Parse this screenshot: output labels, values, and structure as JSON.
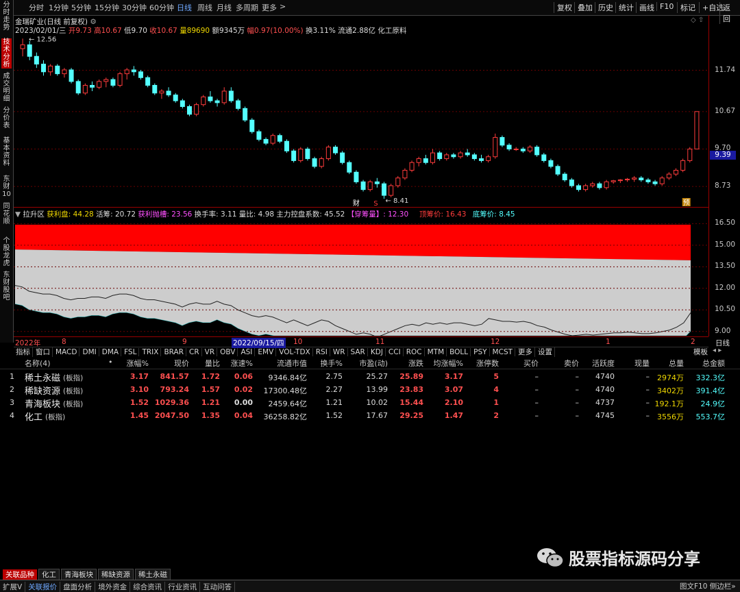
{
  "toolbar": {
    "periods": [
      "分时",
      "1分钟",
      "5分钟",
      "15分钟",
      "30分钟",
      "60分钟",
      "日线",
      "周线",
      "月线",
      "多周期",
      "更多"
    ],
    "active_period": "日线",
    "right_buttons": [
      "复权",
      "叠加",
      "历史",
      "统计",
      "画线",
      "F10",
      "标记",
      "+自选",
      "返回"
    ]
  },
  "sidebar": {
    "items": [
      "分时走势",
      "技术分析",
      "成交明细",
      "分价表",
      "基本资料",
      "东财10",
      "同花顺",
      "个股龙虎",
      "东财股吧"
    ],
    "active": "技术分析"
  },
  "stock": {
    "title": "金瑞矿业(日线 前复权)",
    "date": "2023/02/01/三",
    "open_label": "开",
    "open": "9.73",
    "high_label": "高",
    "high": "10.67",
    "low_label": "低",
    "low": "9.70",
    "close_label": "收",
    "close": "10.67",
    "vol_label": "量",
    "vol": "89690",
    "amt_label": "额",
    "amt": "9345万",
    "chg_label": "幅",
    "chg": "0.97(10.00%)",
    "turn_label": "换",
    "turn": "3.11%",
    "float_label": "流通",
    "float": "2.88亿",
    "industry": "化工原料",
    "max_mark": "12.56",
    "min_mark": "8.41",
    "current_price": "9.39",
    "markers": {
      "cai": "财",
      "s": "S",
      "yu": "预"
    },
    "price_axis": [
      "11.74",
      "10.67",
      "9.70",
      "8.73"
    ]
  },
  "chip": {
    "title": "拉升区",
    "profit_label": "获利盘",
    "profit": "44.28",
    "active_label": "活筹",
    "active": "20.72",
    "retire_label": "获利抛槽",
    "retire": "23.56",
    "turnover_label": "换手率",
    "turnover": "3.11",
    "vr_label": "量比",
    "vr": "4.98",
    "ctrl_label": "主力控盘系数",
    "ctrl": "45.52",
    "cross_label": "【穿筹量】",
    "cross": "12.30",
    "top_label": "顶筹价",
    "top": "16.43",
    "bottom_label": "底筹价",
    "bottom": "8.45",
    "axis": [
      "16.50",
      "15.00",
      "13.50",
      "12.00",
      "10.50",
      "9.00"
    ]
  },
  "timeline": {
    "labels": [
      "2022年",
      "8",
      "9",
      "2022/09/15/四",
      "10",
      "11",
      "12",
      "1",
      "2"
    ],
    "period": "日线"
  },
  "indicator_tabs": [
    "指标",
    "窗口",
    "MACD",
    "DMI",
    "DMA",
    "FSL",
    "TRIX",
    "BRAR",
    "CR",
    "VR",
    "OBV",
    "ASI",
    "EMV",
    "VOL-TDX",
    "RSI",
    "WR",
    "SAR",
    "KDJ",
    "CCI",
    "ROC",
    "MTM",
    "BOLL",
    "PSY",
    "MCST",
    "更多",
    "设置"
  ],
  "template_btn": "模板",
  "table": {
    "headers": [
      "名称(4)",
      "•",
      "涨幅%",
      "现价",
      "量比",
      "涨速%",
      "流通市值",
      "换手%",
      "市盈(动)",
      "涨跌",
      "均涨幅%",
      "涨停数",
      "买价",
      "卖价",
      "活跃度",
      "现量",
      "总量",
      "总金额"
    ],
    "rows": [
      {
        "idx": "1",
        "name": "稀土永磁",
        "tag": "(板指)",
        "chg": "3.17",
        "price": "841.57",
        "vr": "1.72",
        "spd": "0.06",
        "mcap": "9346.84亿",
        "turn": "2.75",
        "pe": "25.27",
        "diff": "25.89",
        "avg": "3.17",
        "limit": "5",
        "buy": "–",
        "sell": "–",
        "act": "4740",
        "cur": "–",
        "vol": "2974万",
        "amt": "332.3亿"
      },
      {
        "idx": "2",
        "name": "稀缺资源",
        "tag": "(板指)",
        "chg": "3.10",
        "price": "793.24",
        "vr": "1.57",
        "spd": "0.02",
        "mcap": "17300.48亿",
        "turn": "2.27",
        "pe": "13.99",
        "diff": "23.83",
        "avg": "3.07",
        "limit": "4",
        "buy": "–",
        "sell": "–",
        "act": "4740",
        "cur": "–",
        "vol": "3402万",
        "amt": "391.4亿"
      },
      {
        "idx": "3",
        "name": "青海板块",
        "tag": "(板指)",
        "chg": "1.52",
        "price": "1029.36",
        "vr": "1.21",
        "spd": "0.00",
        "mcap": "2459.64亿",
        "turn": "1.21",
        "pe": "10.02",
        "diff": "15.44",
        "avg": "2.10",
        "limit": "1",
        "buy": "–",
        "sell": "–",
        "act": "4737",
        "cur": "–",
        "vol": "192.1万",
        "amt": "24.9亿"
      },
      {
        "idx": "4",
        "name": "化工",
        "tag": "(板指)",
        "chg": "1.45",
        "price": "2047.50",
        "vr": "1.35",
        "spd": "0.04",
        "mcap": "36258.82亿",
        "turn": "1.52",
        "pe": "17.67",
        "diff": "29.25",
        "avg": "1.47",
        "limit": "2",
        "buy": "–",
        "sell": "–",
        "act": "4745",
        "cur": "–",
        "vol": "3556万",
        "amt": "553.7亿"
      }
    ]
  },
  "watermark": "股票指标源码分享",
  "bottom_tabs": [
    "关联品种",
    "化工",
    "青海板块",
    "稀缺资源",
    "稀土永磁"
  ],
  "status_bar": [
    "扩展V",
    "关联报价",
    "盘面分析",
    "境外资金",
    "综合资讯",
    "行业资讯",
    "互动问答"
  ],
  "status_right": "图文F10 侧边栏»",
  "colors": {
    "up": "#ff3c3c",
    "down": "#54ffff",
    "accent": "#6fa8ff",
    "yellow": "#f0d800",
    "magenta": "#ff50ff"
  },
  "chart_data": {
    "type": "candlestick",
    "candles": [
      [
        12.3,
        12.56,
        12.1,
        12.4
      ],
      [
        12.4,
        12.5,
        12.0,
        12.1
      ],
      [
        12.1,
        12.2,
        11.8,
        11.9
      ],
      [
        11.9,
        12.0,
        11.6,
        11.7
      ],
      [
        11.7,
        11.9,
        11.6,
        11.85
      ],
      [
        11.85,
        11.9,
        11.6,
        11.65
      ],
      [
        11.65,
        11.8,
        11.55,
        11.75
      ],
      [
        11.75,
        11.8,
        11.4,
        11.45
      ],
      [
        11.45,
        11.5,
        11.1,
        11.15
      ],
      [
        11.15,
        11.4,
        11.1,
        11.35
      ],
      [
        11.35,
        11.45,
        11.2,
        11.3
      ],
      [
        11.3,
        11.5,
        11.25,
        11.45
      ],
      [
        11.45,
        11.55,
        11.3,
        11.5
      ],
      [
        11.5,
        11.55,
        11.3,
        11.35
      ],
      [
        11.35,
        11.7,
        11.3,
        11.65
      ],
      [
        11.65,
        11.8,
        11.5,
        11.75
      ],
      [
        11.75,
        11.85,
        11.6,
        11.7
      ],
      [
        11.7,
        11.75,
        11.5,
        11.55
      ],
      [
        11.55,
        11.6,
        11.3,
        11.35
      ],
      [
        11.35,
        11.4,
        11.1,
        11.15
      ],
      [
        11.15,
        11.25,
        11.0,
        11.2
      ],
      [
        11.2,
        11.3,
        11.05,
        11.1
      ],
      [
        11.1,
        11.15,
        10.9,
        10.95
      ],
      [
        10.95,
        11.0,
        10.75,
        10.8
      ],
      [
        10.8,
        10.85,
        10.55,
        10.6
      ],
      [
        10.6,
        10.9,
        10.55,
        10.85
      ],
      [
        10.85,
        11.1,
        10.8,
        11.05
      ],
      [
        11.05,
        11.2,
        10.9,
        10.95
      ],
      [
        10.95,
        11.0,
        10.8,
        10.9
      ],
      [
        10.9,
        11.3,
        10.85,
        11.2
      ],
      [
        11.2,
        11.3,
        10.9,
        10.95
      ],
      [
        10.95,
        11.0,
        10.7,
        10.75
      ],
      [
        10.75,
        10.8,
        10.4,
        10.45
      ],
      [
        10.45,
        10.5,
        10.1,
        10.15
      ],
      [
        10.15,
        10.2,
        9.9,
        9.95
      ],
      [
        9.95,
        10.0,
        9.8,
        9.85
      ],
      [
        9.85,
        10.1,
        9.8,
        10.05
      ],
      [
        10.05,
        10.1,
        9.85,
        9.9
      ],
      [
        9.9,
        9.95,
        9.6,
        9.65
      ],
      [
        9.65,
        9.7,
        9.35,
        9.4
      ],
      [
        9.4,
        9.75,
        9.35,
        9.7
      ],
      [
        9.7,
        9.75,
        9.4,
        9.45
      ],
      [
        9.45,
        9.5,
        9.2,
        9.25
      ],
      [
        9.25,
        9.5,
        9.2,
        9.45
      ],
      [
        9.45,
        9.8,
        9.4,
        9.75
      ],
      [
        9.75,
        9.8,
        9.55,
        9.6
      ],
      [
        9.6,
        9.65,
        9.3,
        9.35
      ],
      [
        9.35,
        9.4,
        9.05,
        9.1
      ],
      [
        9.1,
        9.15,
        8.8,
        8.85
      ],
      [
        8.85,
        8.9,
        8.6,
        8.65
      ],
      [
        8.65,
        8.9,
        8.6,
        8.85
      ],
      [
        8.85,
        8.95,
        8.7,
        8.8
      ],
      [
        8.8,
        8.85,
        8.41,
        8.5
      ],
      [
        8.5,
        8.8,
        8.45,
        8.75
      ],
      [
        8.75,
        9.0,
        8.7,
        8.95
      ],
      [
        8.95,
        9.2,
        8.9,
        9.15
      ],
      [
        9.15,
        9.4,
        9.1,
        9.35
      ],
      [
        9.35,
        9.5,
        9.25,
        9.45
      ],
      [
        9.45,
        9.55,
        9.3,
        9.35
      ],
      [
        9.35,
        9.7,
        9.3,
        9.6
      ],
      [
        9.6,
        9.65,
        9.4,
        9.45
      ],
      [
        9.45,
        9.6,
        9.4,
        9.55
      ],
      [
        9.55,
        9.6,
        9.45,
        9.5
      ],
      [
        9.5,
        9.65,
        9.45,
        9.6
      ],
      [
        9.6,
        9.7,
        9.5,
        9.55
      ],
      [
        9.55,
        9.6,
        9.4,
        9.45
      ],
      [
        9.45,
        9.55,
        9.35,
        9.4
      ],
      [
        9.4,
        9.55,
        9.35,
        9.5
      ],
      [
        9.5,
        10.1,
        9.45,
        10.0
      ],
      [
        10.0,
        10.05,
        9.75,
        9.8
      ],
      [
        9.8,
        9.85,
        9.65,
        9.7
      ],
      [
        9.7,
        9.75,
        9.65,
        9.7
      ],
      [
        9.7,
        9.75,
        9.6,
        9.65
      ],
      [
        9.65,
        9.8,
        9.6,
        9.75
      ],
      [
        9.75,
        9.8,
        9.5,
        9.55
      ],
      [
        9.55,
        9.6,
        9.35,
        9.4
      ],
      [
        9.4,
        9.45,
        9.2,
        9.25
      ],
      [
        9.25,
        9.3,
        9.0,
        9.05
      ],
      [
        9.05,
        9.1,
        8.85,
        8.9
      ],
      [
        8.9,
        8.95,
        8.7,
        8.75
      ],
      [
        8.75,
        8.8,
        8.6,
        8.65
      ],
      [
        8.65,
        8.8,
        8.6,
        8.75
      ],
      [
        8.75,
        8.85,
        8.7,
        8.8
      ],
      [
        8.8,
        8.85,
        8.65,
        8.7
      ],
      [
        8.7,
        8.9,
        8.65,
        8.85
      ],
      [
        8.85,
        8.9,
        8.8,
        8.88
      ],
      [
        8.88,
        8.92,
        8.82,
        8.9
      ],
      [
        8.9,
        8.95,
        8.85,
        8.92
      ],
      [
        8.92,
        9.0,
        8.85,
        8.95
      ],
      [
        8.95,
        9.0,
        8.85,
        8.9
      ],
      [
        8.9,
        8.95,
        8.8,
        8.85
      ],
      [
        8.85,
        8.9,
        8.75,
        8.8
      ],
      [
        8.8,
        9.0,
        8.75,
        8.95
      ],
      [
        8.95,
        9.1,
        8.9,
        9.05
      ],
      [
        9.05,
        9.2,
        9.0,
        9.15
      ],
      [
        9.15,
        9.45,
        9.1,
        9.4
      ],
      [
        9.4,
        9.75,
        9.35,
        9.7
      ],
      [
        9.7,
        10.67,
        9.7,
        10.67
      ]
    ],
    "cost_line": [
      12.2,
      12.1,
      11.8,
      11.7,
      11.6,
      11.6,
      11.5,
      11.3,
      11.2,
      11.3,
      11.3,
      11.4,
      11.4,
      11.3,
      11.5,
      11.6,
      11.6,
      11.5,
      11.3,
      11.2,
      11.2,
      11.1,
      11.0,
      10.9,
      10.7,
      10.9,
      11.0,
      10.9,
      10.9,
      11.1,
      10.9,
      10.8,
      10.5,
      10.3,
      10.1,
      10.0,
      10.1,
      10.0,
      9.8,
      9.6,
      9.8,
      9.6,
      9.4,
      9.6,
      9.8,
      9.7,
      9.4,
      9.2,
      9.0,
      8.8,
      8.9,
      8.8,
      8.6,
      8.8,
      9.0,
      9.2,
      9.4,
      9.5,
      9.4,
      9.6,
      9.5,
      9.6,
      9.5,
      9.6,
      9.6,
      9.5,
      9.4,
      9.5,
      9.9,
      9.8,
      9.7,
      9.7,
      9.65,
      9.7,
      9.6,
      9.4,
      9.3,
      9.1,
      8.95,
      8.8,
      8.7,
      8.75,
      8.8,
      8.75,
      8.8,
      8.85,
      8.9,
      8.9,
      8.95,
      8.9,
      8.85,
      8.85,
      8.9,
      9.0,
      9.1,
      9.3,
      9.6,
      10.3
    ],
    "chip_top_start": 16.43,
    "chip_top_end": 16.43,
    "chip_profit_start": 14.7,
    "chip_profit_end": 13.95,
    "chip_bottom": 8.45,
    "price_ylim": [
      8.2,
      12.85
    ],
    "chip_ylim": [
      8.7,
      16.9
    ]
  }
}
